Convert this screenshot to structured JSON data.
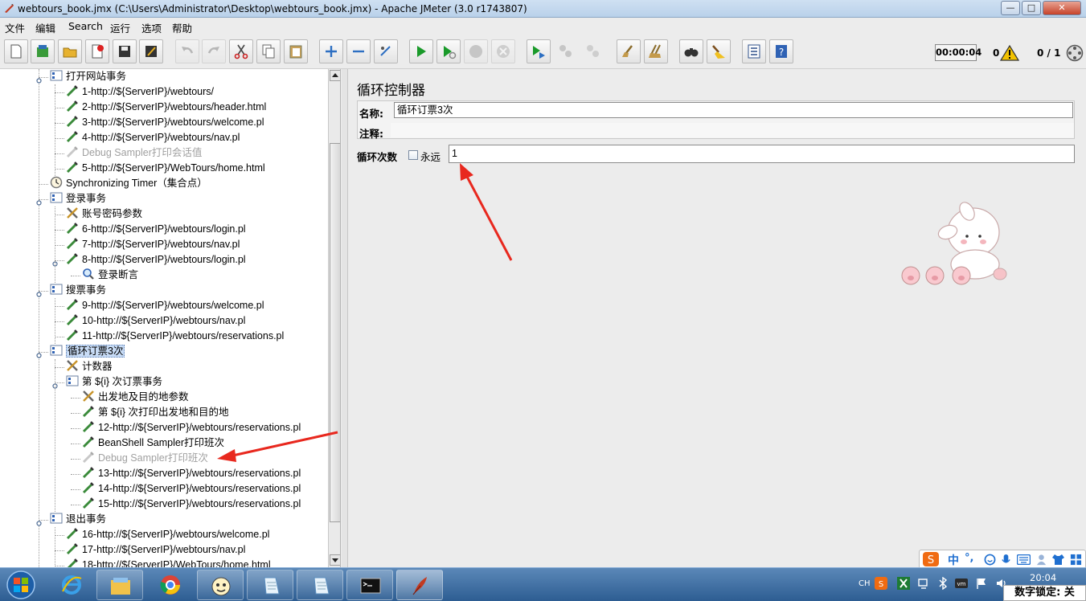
{
  "window": {
    "title": "webtours_book.jmx (C:\\Users\\Administrator\\Desktop\\webtours_book.jmx) - Apache JMeter (3.0 r1743807)",
    "minimize": "—",
    "maximize": "□",
    "close": "✕"
  },
  "menu": {
    "items": [
      "文件",
      "编辑",
      "Search",
      "运行",
      "选项",
      "帮助"
    ]
  },
  "toolbar": {
    "buttons": [
      {
        "name": "new-icon",
        "disabled": false
      },
      {
        "name": "templates-icon",
        "disabled": false
      },
      {
        "name": "open-icon",
        "disabled": false
      },
      {
        "name": "close-icon",
        "disabled": false
      },
      {
        "name": "save-icon",
        "disabled": false
      },
      {
        "name": "save-as-icon",
        "disabled": false
      },
      {
        "name": "undo-icon",
        "disabled": true
      },
      {
        "name": "redo-icon",
        "disabled": true
      },
      {
        "name": "cut-icon",
        "disabled": false
      },
      {
        "name": "copy-icon",
        "disabled": false
      },
      {
        "name": "paste-icon",
        "disabled": false
      },
      {
        "name": "expand-icon",
        "disabled": false
      },
      {
        "name": "collapse-icon",
        "disabled": false
      },
      {
        "name": "toggle-icon",
        "disabled": false
      },
      {
        "name": "start-icon",
        "disabled": false
      },
      {
        "name": "start-no-pause-icon",
        "disabled": false
      },
      {
        "name": "stop-icon",
        "disabled": true
      },
      {
        "name": "shutdown-icon",
        "disabled": true
      },
      {
        "name": "remote-start-icon",
        "disabled": false
      },
      {
        "name": "remote-stop-icon",
        "disabled": true
      },
      {
        "name": "remote-shutdown-icon",
        "disabled": true
      },
      {
        "name": "clear-icon",
        "disabled": false
      },
      {
        "name": "clear-all-icon",
        "disabled": false
      },
      {
        "name": "search-icon",
        "disabled": false
      },
      {
        "name": "reset-search-icon",
        "disabled": false
      },
      {
        "name": "function-helper-icon",
        "disabled": false
      },
      {
        "name": "help-icon",
        "disabled": false
      }
    ],
    "timer": "00:00:04",
    "error_count": "0",
    "thread_count": "0 / 1"
  },
  "tree": {
    "nodes": [
      {
        "label": "打开网站事务",
        "type": "transaction",
        "level": 0
      },
      {
        "label": "1-http://${ServerIP}/webtours/",
        "type": "sampler",
        "level": 1
      },
      {
        "label": "2-http://${ServerIP}/webtours/header.html",
        "type": "sampler",
        "level": 1
      },
      {
        "label": "3-http://${ServerIP}/webtours/welcome.pl",
        "type": "sampler",
        "level": 1
      },
      {
        "label": "4-http://${ServerIP}/webtours/nav.pl",
        "type": "sampler",
        "level": 1
      },
      {
        "label": "Debug Sampler打印会话值",
        "type": "sampler",
        "level": 1,
        "disabled": true
      },
      {
        "label": "5-http://${ServerIP}/WebTours/home.html",
        "type": "sampler",
        "level": 1
      },
      {
        "label": "Synchronizing Timer（集合点）",
        "type": "timer",
        "level": 0
      },
      {
        "label": "登录事务",
        "type": "transaction",
        "level": 0
      },
      {
        "label": "账号密码参数",
        "type": "config",
        "level": 1
      },
      {
        "label": "6-http://${ServerIP}/webtours/login.pl",
        "type": "sampler",
        "level": 1
      },
      {
        "label": "7-http://${ServerIP}/webtours/nav.pl",
        "type": "sampler",
        "level": 1
      },
      {
        "label": "8-http://${ServerIP}/webtours/login.pl",
        "type": "sampler",
        "level": 1
      },
      {
        "label": "登录断言",
        "type": "assertion",
        "level": 2
      },
      {
        "label": "搜票事务",
        "type": "transaction",
        "level": 0
      },
      {
        "label": "9-http://${ServerIP}/webtours/welcome.pl",
        "type": "sampler",
        "level": 1
      },
      {
        "label": "10-http://${ServerIP}/webtours/nav.pl",
        "type": "sampler",
        "level": 1
      },
      {
        "label": "11-http://${ServerIP}/webtours/reservations.pl",
        "type": "sampler",
        "level": 1
      },
      {
        "label": "循环订票3次",
        "type": "loop",
        "level": 0,
        "selected": true
      },
      {
        "label": "计数器",
        "type": "config",
        "level": 1
      },
      {
        "label": "第 ${i} 次订票事务",
        "type": "transaction",
        "level": 1
      },
      {
        "label": "出发地及目的地参数",
        "type": "config",
        "level": 2
      },
      {
        "label": "第 ${i} 次打印出发地和目的地",
        "type": "sampler",
        "level": 2
      },
      {
        "label": "12-http://${ServerIP}/webtours/reservations.pl",
        "type": "sampler",
        "level": 2
      },
      {
        "label": "BeanShell Sampler打印班次",
        "type": "sampler",
        "level": 2
      },
      {
        "label": "Debug Sampler打印班次",
        "type": "sampler",
        "level": 2,
        "disabled": true
      },
      {
        "label": "13-http://${ServerIP}/webtours/reservations.pl",
        "type": "sampler",
        "level": 2
      },
      {
        "label": "14-http://${ServerIP}/webtours/reservations.pl",
        "type": "sampler",
        "level": 2
      },
      {
        "label": "15-http://${ServerIP}/webtours/reservations.pl",
        "type": "sampler",
        "level": 2
      },
      {
        "label": "退出事务",
        "type": "transaction",
        "level": 0
      },
      {
        "label": "16-http://${ServerIP}/webtours/welcome.pl",
        "type": "sampler",
        "level": 1
      },
      {
        "label": "17-http://${ServerIP}/webtours/nav.pl",
        "type": "sampler",
        "level": 1
      },
      {
        "label": "18-http://${ServerIP}/WebTours/home.html",
        "type": "sampler",
        "level": 1
      }
    ]
  },
  "panel": {
    "title": "循环控制器",
    "name_label": "名称:",
    "name_value": "循环订票3次",
    "comment_label": "注释:",
    "comment_value": "",
    "loop_label": "循环次数",
    "forever_label": "永远",
    "forever_checked": false,
    "loop_value": "1"
  },
  "ime": {
    "lang": "中",
    "punct": "°,"
  },
  "tray": {
    "lang": "CH",
    "time": "20:04",
    "numlock": "数字锁定: 关"
  },
  "colors": {
    "selection": "#c8dcf6",
    "arrow": "#e8281e",
    "taskbar": "#2d5d92"
  }
}
